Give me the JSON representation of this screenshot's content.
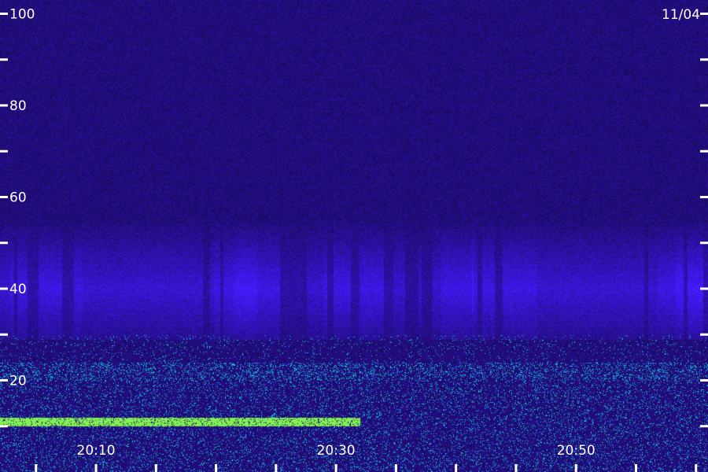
{
  "chart_data": {
    "type": "heatmap",
    "title": "",
    "date_label": "11/04",
    "y_ticks": [
      20,
      40,
      60,
      80,
      100
    ],
    "y_minor_ticks": [
      10,
      30,
      50,
      70,
      90
    ],
    "ylim": [
      0,
      103
    ],
    "x_ticks": [
      "20:10",
      "20:30",
      "20:50"
    ],
    "x_minor_tick_minutes": [
      0,
      5,
      10,
      15,
      20,
      25,
      30,
      35,
      40,
      45,
      50,
      55,
      60
    ],
    "xlim_minutes": [
      2,
      61
    ],
    "colors": {
      "background": "#17083f",
      "low_band": "#3a2ad8",
      "noise_floor": "#1ab0d0",
      "strong_line": "#8bf25a",
      "text": "#ffffff"
    },
    "features": [
      {
        "name": "",
        "freq_low": 29,
        "freq_high": 55,
        "intensity": 0.55
      },
      {
        "name": "",
        "freq_low": 20,
        "freq_high": 24,
        "intensity": 0.8
      },
      {
        "name": "",
        "freq_low": 10,
        "freq_high": 12,
        "intensity": 1.0,
        "minutes": [
          2,
          32
        ]
      }
    ]
  }
}
